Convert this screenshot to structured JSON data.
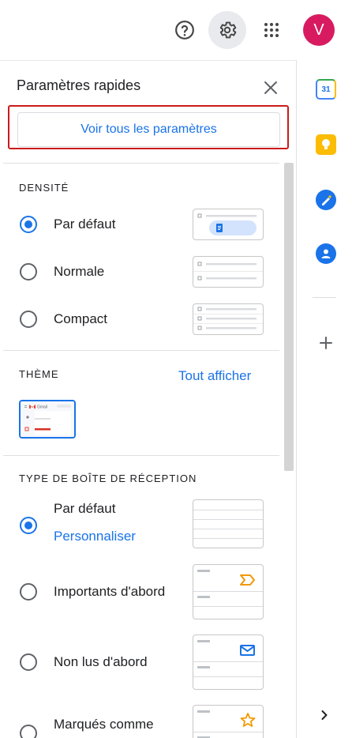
{
  "topbar": {
    "help_icon": "help-circle-icon",
    "settings_icon": "gear-icon",
    "apps_icon": "apps-grid-icon",
    "avatar_letter": "V",
    "avatar_color": "#d81b60"
  },
  "panel": {
    "title": "Paramètres rapides",
    "close_icon": "close-icon",
    "see_all_label": "Voir tous les paramètres"
  },
  "density": {
    "section_label": "DENSITÉ",
    "options": [
      {
        "label": "Par défaut",
        "selected": true
      },
      {
        "label": "Normale",
        "selected": false
      },
      {
        "label": "Compact",
        "selected": false
      }
    ]
  },
  "theme": {
    "section_label": "THÈME",
    "show_all_label": "Tout afficher",
    "thumb_brand": "Gmail"
  },
  "inbox_type": {
    "section_label": "TYPE DE BOÎTE DE RÉCEPTION",
    "options": [
      {
        "label": "Par défaut",
        "selected": true,
        "link": "Personnaliser"
      },
      {
        "label": "Importants d'abord",
        "selected": false,
        "icon": "important-marker-icon"
      },
      {
        "label": "Non lus d'abord",
        "selected": false,
        "icon": "mail-icon"
      },
      {
        "label": "Marqués comme",
        "selected": false,
        "icon": "star-icon"
      }
    ]
  },
  "rail": {
    "calendar_day": "31",
    "items": [
      "calendar-icon",
      "keep-icon",
      "tasks-icon",
      "contacts-icon",
      "add-icon",
      "chevron-right-icon"
    ]
  },
  "colors": {
    "accent": "#1a73e8",
    "highlight_outline": "#cc1a1a"
  }
}
